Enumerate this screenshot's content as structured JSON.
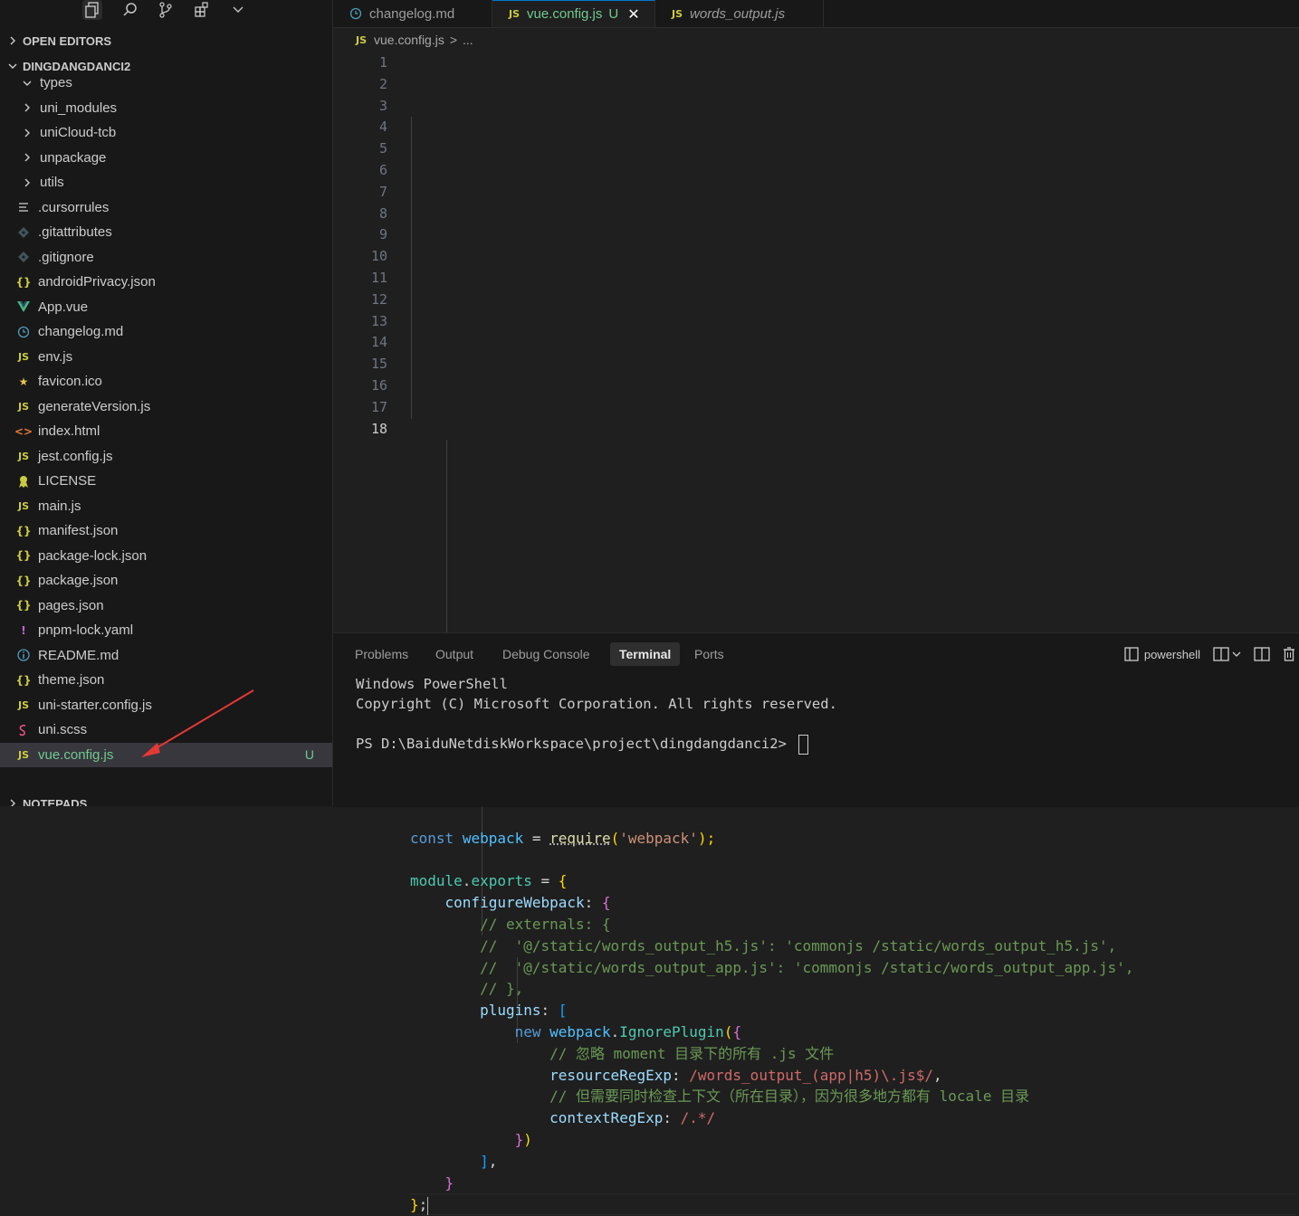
{
  "explorer": {
    "open_editors_label": "OPEN EDITORS",
    "project_label": "DINGDANGDANCI2",
    "notepads_label": "NOTEPADS",
    "items": [
      {
        "label": "types",
        "kind": "folder-open"
      },
      {
        "label": "uni_modules",
        "kind": "folder"
      },
      {
        "label": "uniCloud-tcb",
        "kind": "folder"
      },
      {
        "label": "unpackage",
        "kind": "folder"
      },
      {
        "label": "utils",
        "kind": "folder"
      },
      {
        "label": ".cursorrules",
        "kind": "lines"
      },
      {
        "label": ".gitattributes",
        "kind": "git"
      },
      {
        "label": ".gitignore",
        "kind": "git"
      },
      {
        "label": "androidPrivacy.json",
        "kind": "json"
      },
      {
        "label": "App.vue",
        "kind": "vue"
      },
      {
        "label": "changelog.md",
        "kind": "clock"
      },
      {
        "label": "env.js",
        "kind": "js"
      },
      {
        "label": "favicon.ico",
        "kind": "star"
      },
      {
        "label": "generateVersion.js",
        "kind": "js"
      },
      {
        "label": "index.html",
        "kind": "html"
      },
      {
        "label": "jest.config.js",
        "kind": "js"
      },
      {
        "label": "LICENSE",
        "kind": "license"
      },
      {
        "label": "main.js",
        "kind": "js"
      },
      {
        "label": "manifest.json",
        "kind": "json"
      },
      {
        "label": "package-lock.json",
        "kind": "json"
      },
      {
        "label": "package.json",
        "kind": "json"
      },
      {
        "label": "pages.json",
        "kind": "json"
      },
      {
        "label": "pnpm-lock.yaml",
        "kind": "yaml"
      },
      {
        "label": "README.md",
        "kind": "info"
      },
      {
        "label": "theme.json",
        "kind": "json"
      },
      {
        "label": "uni-starter.config.js",
        "kind": "js"
      },
      {
        "label": "uni.scss",
        "kind": "scss"
      },
      {
        "label": "vue.config.js",
        "kind": "js",
        "badge": "U"
      }
    ]
  },
  "tabs": [
    {
      "label": "changelog.md",
      "icon": "clock"
    },
    {
      "label": "vue.config.js",
      "icon": "JS",
      "status": "U"
    },
    {
      "label": "words_output.js",
      "icon": "JS"
    }
  ],
  "breadcrumb": {
    "icon": "JS",
    "file": "vue.config.js",
    "sep": ">",
    "more": "..."
  },
  "editor": {
    "line_numbers": [
      "1",
      "2",
      "3",
      "4",
      "5",
      "6",
      "7",
      "8",
      "9",
      "10",
      "11",
      "12",
      "13",
      "14",
      "15",
      "16",
      "17",
      "18"
    ],
    "current_line": "18",
    "code": {
      "l1": [
        "const",
        " ",
        "webpack",
        " = ",
        "require",
        "(",
        "'webpack'",
        ");"
      ],
      "l3": [
        "module",
        ".",
        "exports",
        " = ",
        "{"
      ],
      "l4": [
        "configureWebpack",
        ": ",
        "{"
      ],
      "l5": "// externals: {",
      "l6": "//  '@/static/words_output_h5.js': 'commonjs /static/words_output_h5.js',",
      "l7": "//  '@/static/words_output_app.js': 'commonjs /static/words_output_app.js',",
      "l8": "// },",
      "l9": [
        "plugins",
        ": ",
        "["
      ],
      "l10": [
        "new",
        " ",
        "webpack",
        ".",
        "IgnorePlugin",
        "(",
        "{"
      ],
      "l11": "// 忽略 moment 目录下的所有 .js 文件",
      "l12": [
        "resourceRegExp",
        ": ",
        "/words_output_(app|h5)\\.js$/",
        ","
      ],
      "l13": "// 但需要同时检查上下文（所在目录），因为很多地方都有 locale 目录",
      "l14": [
        "contextRegExp",
        ": ",
        "/.*/"
      ],
      "l15": [
        "}",
        ")"
      ],
      "l16": [
        "]",
        ","
      ],
      "l17": "}",
      "l18": [
        "}",
        ";"
      ]
    }
  },
  "panel": {
    "tabs": [
      "Problems",
      "Output",
      "Debug Console",
      "Terminal",
      "Ports"
    ],
    "active_tab": "Terminal",
    "shell_label": "powershell",
    "terminal_lines": [
      "Windows PowerShell",
      "Copyright (C) Microsoft Corporation. All rights reserved.",
      "",
      "PS D:\\BaiduNetdiskWorkspace\\project\\dingdangdanci2> "
    ]
  },
  "colors": {
    "accent": "#0078d4",
    "modified": "#73c991",
    "js_icon": "#cbcb41",
    "annotation_arrow": "#e53935"
  }
}
